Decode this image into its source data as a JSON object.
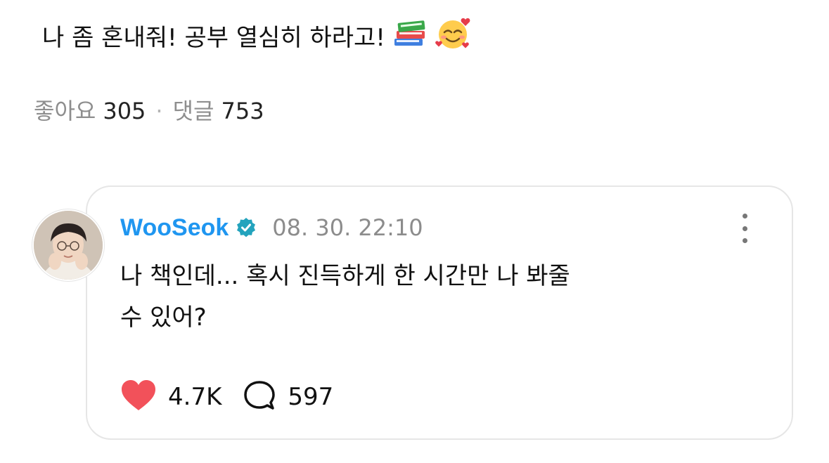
{
  "post": {
    "text": "나 좀 혼내줘! 공부 열심히 하라고!",
    "emojis": [
      "books-emoji",
      "smiling-face-with-hearts-emoji"
    ],
    "likes_label": "좋아요",
    "likes_count": "305",
    "separator": "·",
    "comments_label": "댓글",
    "comments_count": "753"
  },
  "comment": {
    "author": "WooSeok",
    "verified": true,
    "timestamp": "08. 30. 22:10",
    "text_line1": "나 책인데... 혹시 진득하게 한 시간만 나 봐줄",
    "text_line2": "수 있어?",
    "like_count": "4.7K",
    "reply_count": "597"
  },
  "colors": {
    "author": "#1f96f0",
    "verified_badge": "#23a3bd",
    "heart": "#f2515a",
    "muted": "#8e8e8e",
    "card_border": "#e6e6e6"
  }
}
